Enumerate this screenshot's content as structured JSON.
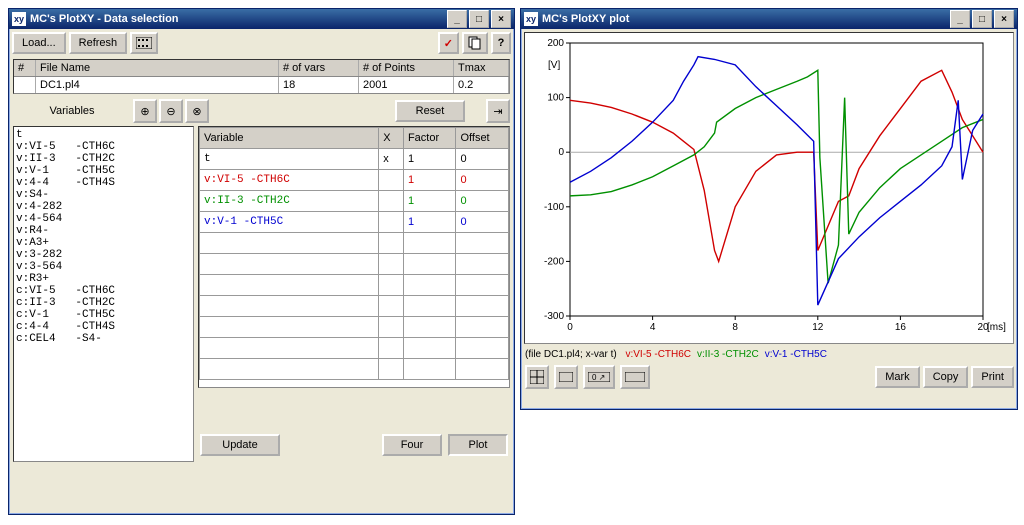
{
  "dataWindow": {
    "title": "MC's PlotXY - Data selection",
    "toolbar": {
      "load": "Load...",
      "refresh": "Refresh"
    },
    "filesHeader": {
      "num": "#",
      "name": "File Name",
      "vars": "# of vars",
      "points": "# of Points",
      "tmax": "Tmax"
    },
    "files": [
      {
        "num": "",
        "name": "DC1.pl4",
        "vars": "18",
        "points": "2001",
        "tmax": "0.2"
      }
    ],
    "variablesLabel": "Variables",
    "resetLabel": "Reset",
    "plusLabel": "⊕",
    "minusLabel": "⊖",
    "timesLabel": "⊗",
    "varList": [
      "t",
      "v:VI-5   -CTH6C",
      "v:II-3   -CTH2C",
      "v:V-1    -CTH5C",
      "v:4-4    -CTH4S",
      "v:S4-",
      "v:4-282",
      "v:4-564",
      "v:R4-",
      "v:A3+",
      "v:3-282",
      "v:3-564",
      "v:R3+",
      "c:VI-5   -CTH6C",
      "c:II-3   -CTH2C",
      "c:V-1    -CTH5C",
      "c:4-4    -CTH4S",
      "c:CEL4   -S4-"
    ],
    "selHeader": {
      "var": "Variable",
      "x": "X",
      "factor": "Factor",
      "offset": "Offset"
    },
    "selected": [
      {
        "var": "t",
        "x": "x",
        "factor": "1",
        "offset": "0",
        "color": "#000"
      },
      {
        "var": "v:VI-5   -CTH6C",
        "x": "",
        "factor": "1",
        "offset": "0",
        "color": "#d00000"
      },
      {
        "var": "v:II-3   -CTH2C",
        "x": "",
        "factor": "1",
        "offset": "0",
        "color": "#009000"
      },
      {
        "var": "v:V-1    -CTH5C",
        "x": "",
        "factor": "1",
        "offset": "0",
        "color": "#0000d0"
      }
    ],
    "updateLabel": "Update",
    "fourLabel": "Four",
    "plotLabel": "Plot"
  },
  "plotWindow": {
    "title": "MC's PlotXY plot",
    "legendFile": "(file DC1.pl4; x-var t)",
    "legend": [
      {
        "text": "v:VI-5  -CTH6C",
        "color": "#d00000"
      },
      {
        "text": "v:II-3  -CTH2C",
        "color": "#009000"
      },
      {
        "text": "v:V-1   -CTH5C",
        "color": "#0000d0"
      }
    ],
    "markLabel": "Mark",
    "copyLabel": "Copy",
    "printLabel": "Print",
    "yLabel": "[V]",
    "xLabel": "[ms]"
  },
  "chart_data": {
    "type": "line",
    "xlabel": "[ms]",
    "ylabel": "[V]",
    "xlim": [
      0,
      20
    ],
    "ylim": [
      -300,
      200
    ],
    "xticks": [
      0,
      4,
      8,
      12,
      16,
      20
    ],
    "yticks": [
      -300,
      -200,
      -100,
      0,
      100,
      200
    ],
    "series": [
      {
        "name": "v:VI-5 -CTH6C",
        "color": "#d00000",
        "x": [
          0,
          1,
          2,
          3,
          4,
          5,
          5.5,
          6,
          6.5,
          7,
          7.2,
          8,
          9,
          10,
          11,
          11.8,
          12,
          13,
          13.5,
          14,
          15,
          16,
          17,
          18,
          18.5,
          19,
          20
        ],
        "y": [
          95,
          90,
          82,
          70,
          55,
          35,
          20,
          5,
          -70,
          -180,
          -200,
          -100,
          -35,
          -5,
          0,
          0,
          -180,
          -90,
          -80,
          -30,
          30,
          80,
          130,
          150,
          110,
          60,
          0
        ]
      },
      {
        "name": "v:II-3 -CTH2C",
        "color": "#009000",
        "x": [
          0,
          1,
          2,
          3,
          4,
          5,
          6,
          6.5,
          7,
          7.1,
          8,
          9,
          10,
          11,
          11.5,
          12,
          12.1,
          12.5,
          13,
          13.3,
          13.5,
          14,
          15,
          16,
          17,
          18,
          19,
          20
        ],
        "y": [
          -80,
          -78,
          -72,
          -60,
          -45,
          -25,
          -5,
          10,
          35,
          55,
          80,
          100,
          115,
          130,
          138,
          150,
          -10,
          -240,
          -170,
          100,
          -150,
          -110,
          -65,
          -30,
          -5,
          20,
          45,
          60
        ]
      },
      {
        "name": "v:V-1 -CTH5C",
        "color": "#0000d0",
        "x": [
          0,
          1,
          2,
          3,
          4,
          5,
          5.5,
          6,
          6.2,
          7,
          8,
          9,
          10,
          11,
          11.8,
          12,
          13,
          14,
          15,
          16,
          17,
          18,
          18.5,
          18.8,
          19,
          19.5,
          20
        ],
        "y": [
          -55,
          -35,
          -10,
          20,
          55,
          95,
          130,
          160,
          175,
          170,
          160,
          120,
          85,
          50,
          20,
          -280,
          -195,
          -155,
          -120,
          -90,
          -60,
          -25,
          10,
          95,
          -50,
          40,
          70
        ]
      }
    ]
  }
}
